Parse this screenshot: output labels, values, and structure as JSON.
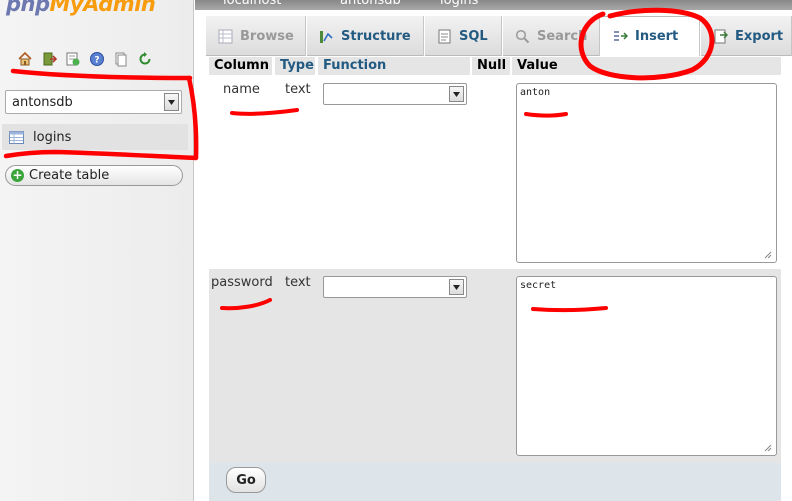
{
  "app": {
    "logo_part1": "php",
    "logo_part2": "MyAdmin"
  },
  "left_nav": {
    "icons": [
      "home-icon",
      "exit-icon",
      "query-window-icon",
      "docs-icon",
      "sql-docs-icon",
      "reload-icon"
    ],
    "database_select": {
      "value": "antonsdb"
    },
    "table_item": {
      "label": "logins",
      "icon": "table-icon"
    },
    "create_table": {
      "label": "Create table",
      "icon": "plus-circle-icon"
    }
  },
  "breadcrumb": {
    "server": "localhost",
    "database": "antonsdb",
    "table": "logins"
  },
  "tabs": [
    {
      "label": "Browse",
      "icon": "browse-icon",
      "state": "disabled"
    },
    {
      "label": "Structure",
      "icon": "structure-icon",
      "state": "normal"
    },
    {
      "label": "SQL",
      "icon": "sql-icon",
      "state": "normal"
    },
    {
      "label": "Search",
      "icon": "search-icon",
      "state": "disabled"
    },
    {
      "label": "Insert",
      "icon": "insert-icon",
      "state": "active"
    },
    {
      "label": "Export",
      "icon": "export-icon",
      "state": "normal"
    }
  ],
  "form": {
    "headers": {
      "column": "Column",
      "type": "Type",
      "function": "Function",
      "null": "Null",
      "value": "Value"
    },
    "rows": [
      {
        "column": "name",
        "type": "text",
        "function": "",
        "value": "anton"
      },
      {
        "column": "password",
        "type": "text",
        "function": "",
        "value": "secret"
      }
    ],
    "go_label": "Go"
  },
  "colors": {
    "annotation_red": "#ff0000",
    "link_blue": "#235a81",
    "logo_blue": "#6c78af",
    "logo_orange": "#f89c0e"
  }
}
